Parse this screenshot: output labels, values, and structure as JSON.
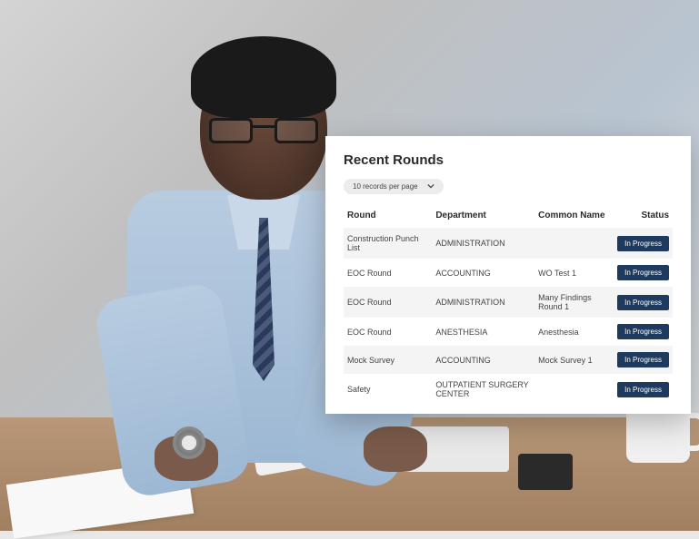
{
  "panel": {
    "title": "Recent Rounds",
    "pager_label": "10 records per page",
    "columns": {
      "round": "Round",
      "department": "Department",
      "common_name": "Common Name",
      "status": "Status"
    },
    "rows": [
      {
        "round": "Construction Punch List",
        "department": "ADMINISTRATION",
        "common_name": "",
        "status": "In Progress"
      },
      {
        "round": "EOC Round",
        "department": "ACCOUNTING",
        "common_name": "WO Test 1",
        "status": "In Progress"
      },
      {
        "round": "EOC Round",
        "department": "ADMINISTRATION",
        "common_name": "Many Findings Round 1",
        "status": "In Progress"
      },
      {
        "round": "EOC Round",
        "department": "ANESTHESIA",
        "common_name": "Anesthesia",
        "status": "In Progress"
      },
      {
        "round": "Mock Survey",
        "department": "ACCOUNTING",
        "common_name": "Mock Survey 1",
        "status": "In Progress"
      },
      {
        "round": "Safety",
        "department": "OUTPATIENT SURGERY CENTER",
        "common_name": "",
        "status": "In Progress"
      }
    ]
  },
  "colors": {
    "badge_bg": "#1e3a5f",
    "panel_bg": "#ffffff",
    "row_alt": "#f4f4f4"
  }
}
